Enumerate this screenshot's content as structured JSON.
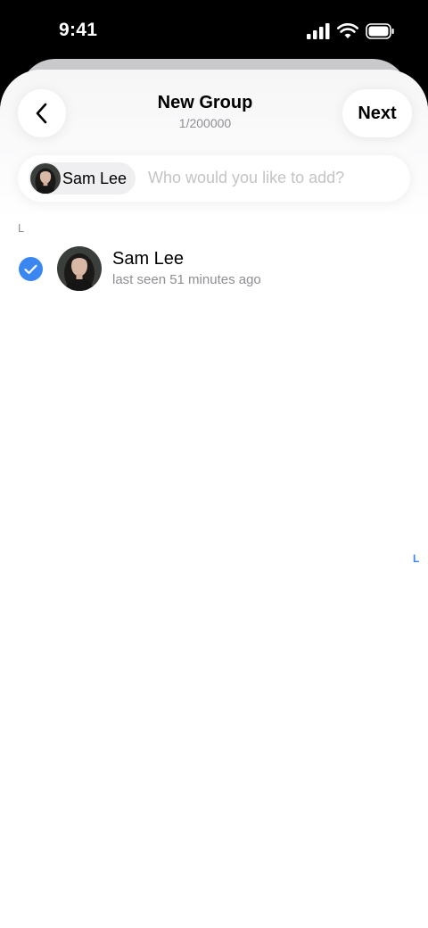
{
  "status_bar": {
    "time": "9:41"
  },
  "header": {
    "title": "New Group",
    "subtitle": "1/200000",
    "next_label": "Next"
  },
  "search": {
    "chip_label": "Sam Lee",
    "placeholder": "Who would you like to add?"
  },
  "section_letter": "L",
  "contacts": [
    {
      "name": "Sam Lee",
      "status": "last seen 51 minutes ago",
      "selected": true
    }
  ],
  "index_letters": [
    "L"
  ],
  "colors": {
    "accent": "#3a87f2",
    "secondary_text": "#8e8e93",
    "placeholder": "#c4c4c7"
  }
}
